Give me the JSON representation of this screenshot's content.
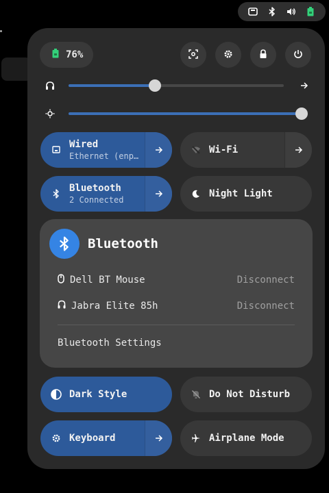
{
  "topbar": {
    "icons": [
      "screen-share-icon",
      "bluetooth-icon",
      "volume-icon",
      "battery-icon"
    ]
  },
  "battery": {
    "percent": "76%"
  },
  "header_buttons": [
    "screenshot-icon",
    "settings-icon",
    "lock-icon",
    "power-icon"
  ],
  "sliders": {
    "volume": {
      "icon": "headphones-icon",
      "level": 0.4
    },
    "brightness": {
      "icon": "brightness-icon",
      "level": 1.0
    }
  },
  "tiles": {
    "wired": {
      "title": "Wired",
      "subtitle": "Ethernet (enp…",
      "active": true
    },
    "wifi": {
      "title": "Wi-Fi",
      "active": false
    },
    "bluetooth": {
      "title": "Bluetooth",
      "subtitle": "2 Connected",
      "active": true
    },
    "night_light": {
      "title": "Night Light",
      "active": false
    },
    "dark_style": {
      "title": "Dark Style",
      "active": true
    },
    "dnd": {
      "title": "Do Not Disturb",
      "active": false
    },
    "keyboard": {
      "title": "Keyboard",
      "active": true
    },
    "airplane": {
      "title": "Airplane Mode",
      "active": false
    }
  },
  "bluetooth_menu": {
    "title": "Bluetooth",
    "devices": [
      {
        "name": "Dell BT Mouse",
        "icon": "mouse-icon",
        "action": "Disconnect"
      },
      {
        "name": "Jabra Elite 85h",
        "icon": "headset-icon",
        "action": "Disconnect"
      }
    ],
    "settings_label": "Bluetooth Settings"
  },
  "colors": {
    "accent": "#3584e4",
    "tile_active": "#2d5a9a",
    "panel_bg": "#2a2a2a",
    "battery_green": "#33d17a"
  }
}
